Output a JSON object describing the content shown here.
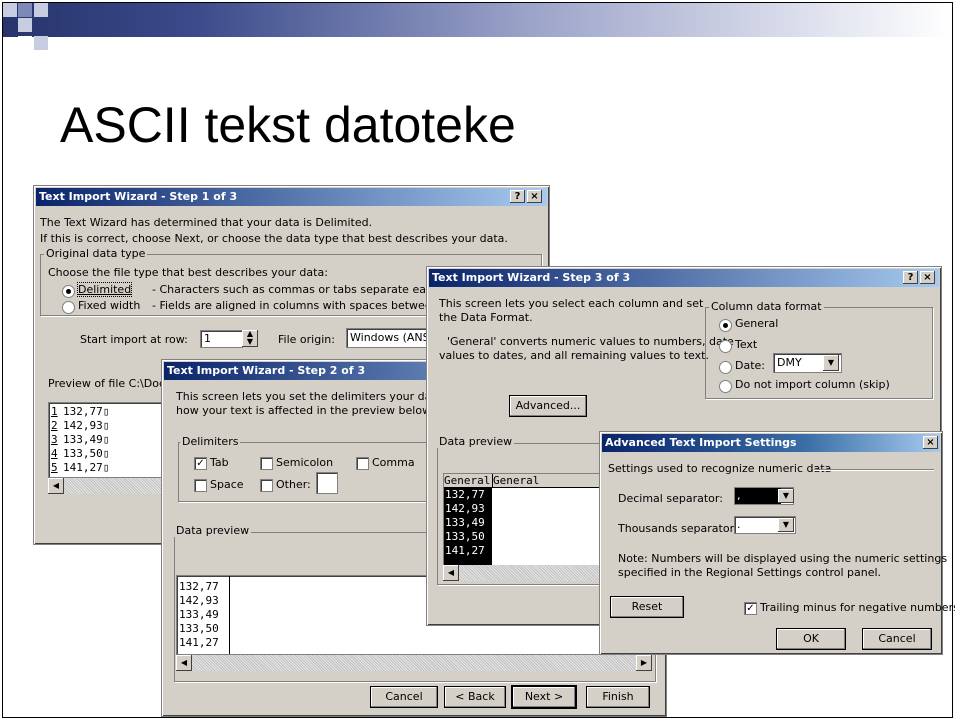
{
  "slide": {
    "title": "ASCII tekst datoteke"
  },
  "step1": {
    "title": "Text Import Wizard - Step 1 of 3",
    "help": "?",
    "close": "×",
    "intro1": "The Text Wizard has determined that your data is Delimited.",
    "intro2": "If this is correct, choose Next, or choose the data type that best describes your data.",
    "group_label": "Original data type",
    "choose": "Choose the file type that best describes your data:",
    "delimited": "Delimited",
    "delimited_desc": "- Characters such as commas or tabs separate each field",
    "fixed": "Fixed width",
    "fixed_desc": "- Fields are aligned in columns with spaces between each",
    "start_row_label": "Start import at row:",
    "start_row_value": "1",
    "origin_label": "File origin:",
    "origin_value": "Windows (ANSI)",
    "preview_label": "Preview of file C:\\Docu",
    "rows": [
      {
        "n": "1",
        "v": "132,77▯"
      },
      {
        "n": "2",
        "v": "142,93▯"
      },
      {
        "n": "3",
        "v": "133,49▯"
      },
      {
        "n": "4",
        "v": "133,50▯"
      },
      {
        "n": "5",
        "v": "141,27▯"
      }
    ]
  },
  "step2": {
    "title": "Text Import Wizard - Step 2 of 3",
    "intro1": "This screen lets you set the delimiters your data co",
    "intro2": "how your text is affected in the preview below.",
    "delimiters_label": "Delimiters",
    "tab": "Tab",
    "semicolon": "Semicolon",
    "comma": "Comma",
    "space": "Space",
    "other": "Other:",
    "tab_checked": true,
    "preview_label": "Data preview",
    "rows": [
      "132,77",
      "142,93",
      "133,49",
      "133,50",
      "141,27"
    ],
    "cancel": "Cancel",
    "back": "< Back",
    "next": "Next >",
    "finish": "Finish"
  },
  "step3": {
    "title": "Text Import Wizard - Step 3 of 3",
    "help": "?",
    "close": "×",
    "intro1": "This screen lets you select each column and set",
    "intro2": "the Data Format.",
    "intro3": "'General' converts numeric values to numbers, date",
    "intro4": "values to dates, and all remaining values to text.",
    "advanced": "Advanced...",
    "format_label": "Column data format",
    "general": "General",
    "text": "Text",
    "date": "Date:",
    "date_value": "DMY",
    "skip": "Do not import column (skip)",
    "preview_label": "Data preview",
    "col1": "General",
    "col2": "General",
    "rows": [
      "132,77",
      "142,93",
      "133,49",
      "133,50",
      "141,27"
    ]
  },
  "adv": {
    "title": "Advanced Text Import Settings",
    "close": "×",
    "settings_label": "Settings used to recognize numeric data",
    "decimal_label": "Decimal separator:",
    "decimal_value": ",",
    "thousands_label": "Thousands separator:",
    "thousands_value": ".",
    "note1": "Note: Numbers will be displayed using the numeric settings",
    "note2": "specified in the Regional Settings control panel.",
    "reset": "Reset",
    "trailing": "Trailing minus for negative numbers",
    "trailing_checked": true,
    "ok": "OK",
    "cancel": "Cancel"
  },
  "colors": {
    "titlebar_start": "#0a246a",
    "titlebar_end": "#a6caf0",
    "window": "#d4d0c8",
    "deco_dark": "#27346c",
    "deco_light": "#c8cce0"
  }
}
